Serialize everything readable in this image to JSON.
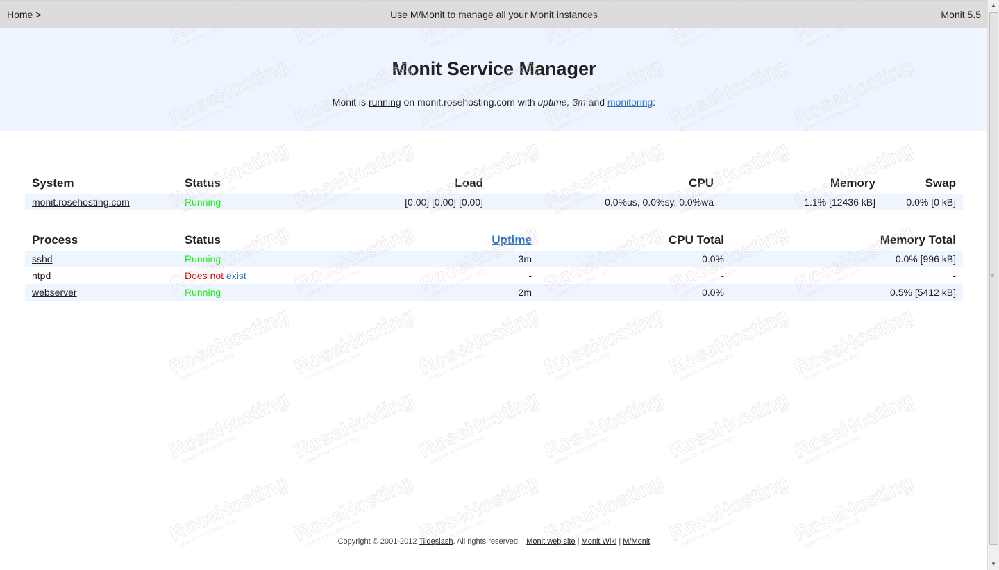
{
  "topbar": {
    "home_label": "Home",
    "home_sep": " >",
    "use_prefix": "Use ",
    "mmonit_link": "M/Monit",
    "use_suffix": " to manage all your Monit instances",
    "version": "Monit 5.5"
  },
  "header": {
    "title": "Monit Service Manager",
    "status_prefix": "Monit is ",
    "status_running": "running",
    "status_on": " on monit.rosehosting.com with ",
    "status_uptime": "uptime, 3m",
    "status_and": " and ",
    "status_monitoring": "monitoring",
    "status_colon": ":"
  },
  "system_table": {
    "headers": [
      "System",
      "Status",
      "Load",
      "CPU",
      "Memory",
      "Swap"
    ],
    "rows": [
      {
        "name": "monit.rosehosting.com",
        "status": "Running",
        "load": "[0.00] [0.00] [0.00]",
        "cpu": "0.0%us, 0.0%sy, 0.0%wa",
        "memory": "1.1% [12436 kB]",
        "swap": "0.0% [0 kB]"
      }
    ]
  },
  "process_table": {
    "headers": [
      "Process",
      "Status",
      "Uptime",
      "CPU Total",
      "Memory Total"
    ],
    "rows": [
      {
        "name": "sshd",
        "status": "Running",
        "uptime": "3m",
        "cpu": "0.0%",
        "memory": "0.0% [996 kB]"
      },
      {
        "name": "ntpd",
        "status_prefix": "Does not ",
        "status_link": "exist",
        "uptime": "-",
        "cpu": "-",
        "memory": "-"
      },
      {
        "name": "webserver",
        "status": "Running",
        "uptime": "2m",
        "cpu": "0.0%",
        "memory": "0.5% [5412 kB]"
      }
    ]
  },
  "footer": {
    "copyright": "Copyright © 2001-2012 ",
    "tildeslash": "Tildeslash",
    "rights": ". All rights reserved.   ",
    "web_site": "Monit web site",
    "sep1": " | ",
    "wiki": "Monit Wiki",
    "sep2": " | ",
    "mmonit": "M/Monit"
  },
  "watermark": {
    "brand": "RoseHosting",
    "tagline": "QUALITY VPS SINCE 2001"
  },
  "colors": {
    "running": "#11ee11",
    "error": "#dd0000",
    "header_bg": "#eef5ff",
    "topbar_bg": "#dcdcdc",
    "link_blue": "#2a6fbf"
  }
}
